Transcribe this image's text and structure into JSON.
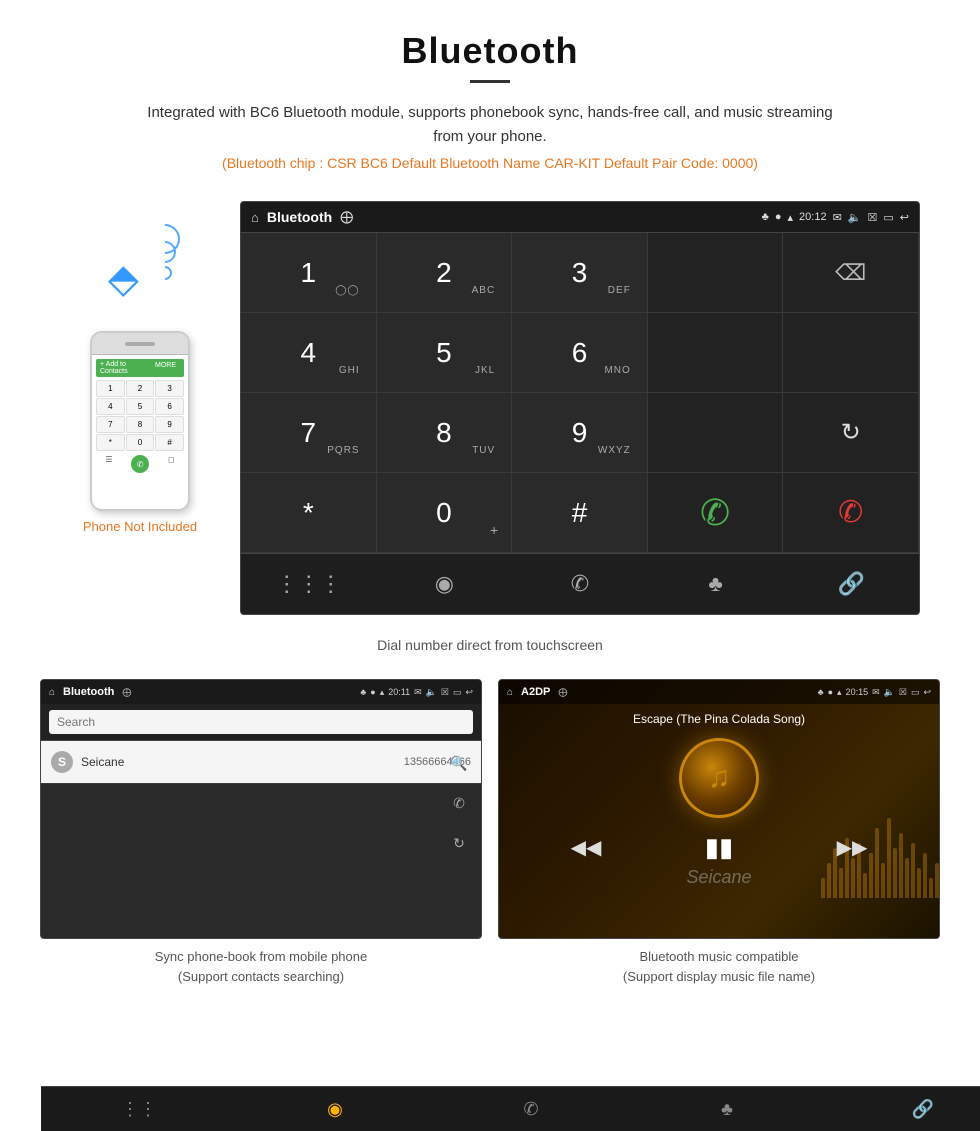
{
  "header": {
    "title": "Bluetooth",
    "subtitle": "Integrated with BC6 Bluetooth module, supports phonebook sync, hands-free call, and music streaming from your phone.",
    "chip_info": "(Bluetooth chip : CSR BC6    Default Bluetooth Name CAR-KIT    Default Pair Code: 0000)"
  },
  "phone_label": "Phone Not Included",
  "dialpad": {
    "screen_title": "Bluetooth",
    "time": "20:12",
    "keys": [
      {
        "main": "1",
        "sub": ""
      },
      {
        "main": "2",
        "sub": "ABC"
      },
      {
        "main": "3",
        "sub": "DEF"
      },
      {
        "main": "",
        "sub": ""
      },
      {
        "main": "⌫",
        "sub": ""
      },
      {
        "main": "4",
        "sub": "GHI"
      },
      {
        "main": "5",
        "sub": "JKL"
      },
      {
        "main": "6",
        "sub": "MNO"
      },
      {
        "main": "",
        "sub": ""
      },
      {
        "main": "",
        "sub": ""
      },
      {
        "main": "7",
        "sub": "PQRS"
      },
      {
        "main": "8",
        "sub": "TUV"
      },
      {
        "main": "9",
        "sub": "WXYZ"
      },
      {
        "main": "",
        "sub": ""
      },
      {
        "main": "↻",
        "sub": ""
      },
      {
        "main": "*",
        "sub": ""
      },
      {
        "main": "0",
        "sub": "+"
      },
      {
        "main": "#",
        "sub": ""
      },
      {
        "main": "📞",
        "sub": ""
      },
      {
        "main": "📞",
        "sub": ""
      }
    ]
  },
  "dial_caption": "Dial number direct from touchscreen",
  "phonebook": {
    "screen_title": "Bluetooth",
    "time": "20:11",
    "search_placeholder": "Search",
    "contact_name": "Seicane",
    "contact_number": "13566664466",
    "contact_letter": "S"
  },
  "phonebook_caption": "Sync phone-book from mobile phone\n(Support contacts searching)",
  "music": {
    "screen_title": "A2DP",
    "time": "20:15",
    "song_title": "Escape (The Pina Colada Song)"
  },
  "music_caption": "Bluetooth music compatible\n(Support display music file name)"
}
